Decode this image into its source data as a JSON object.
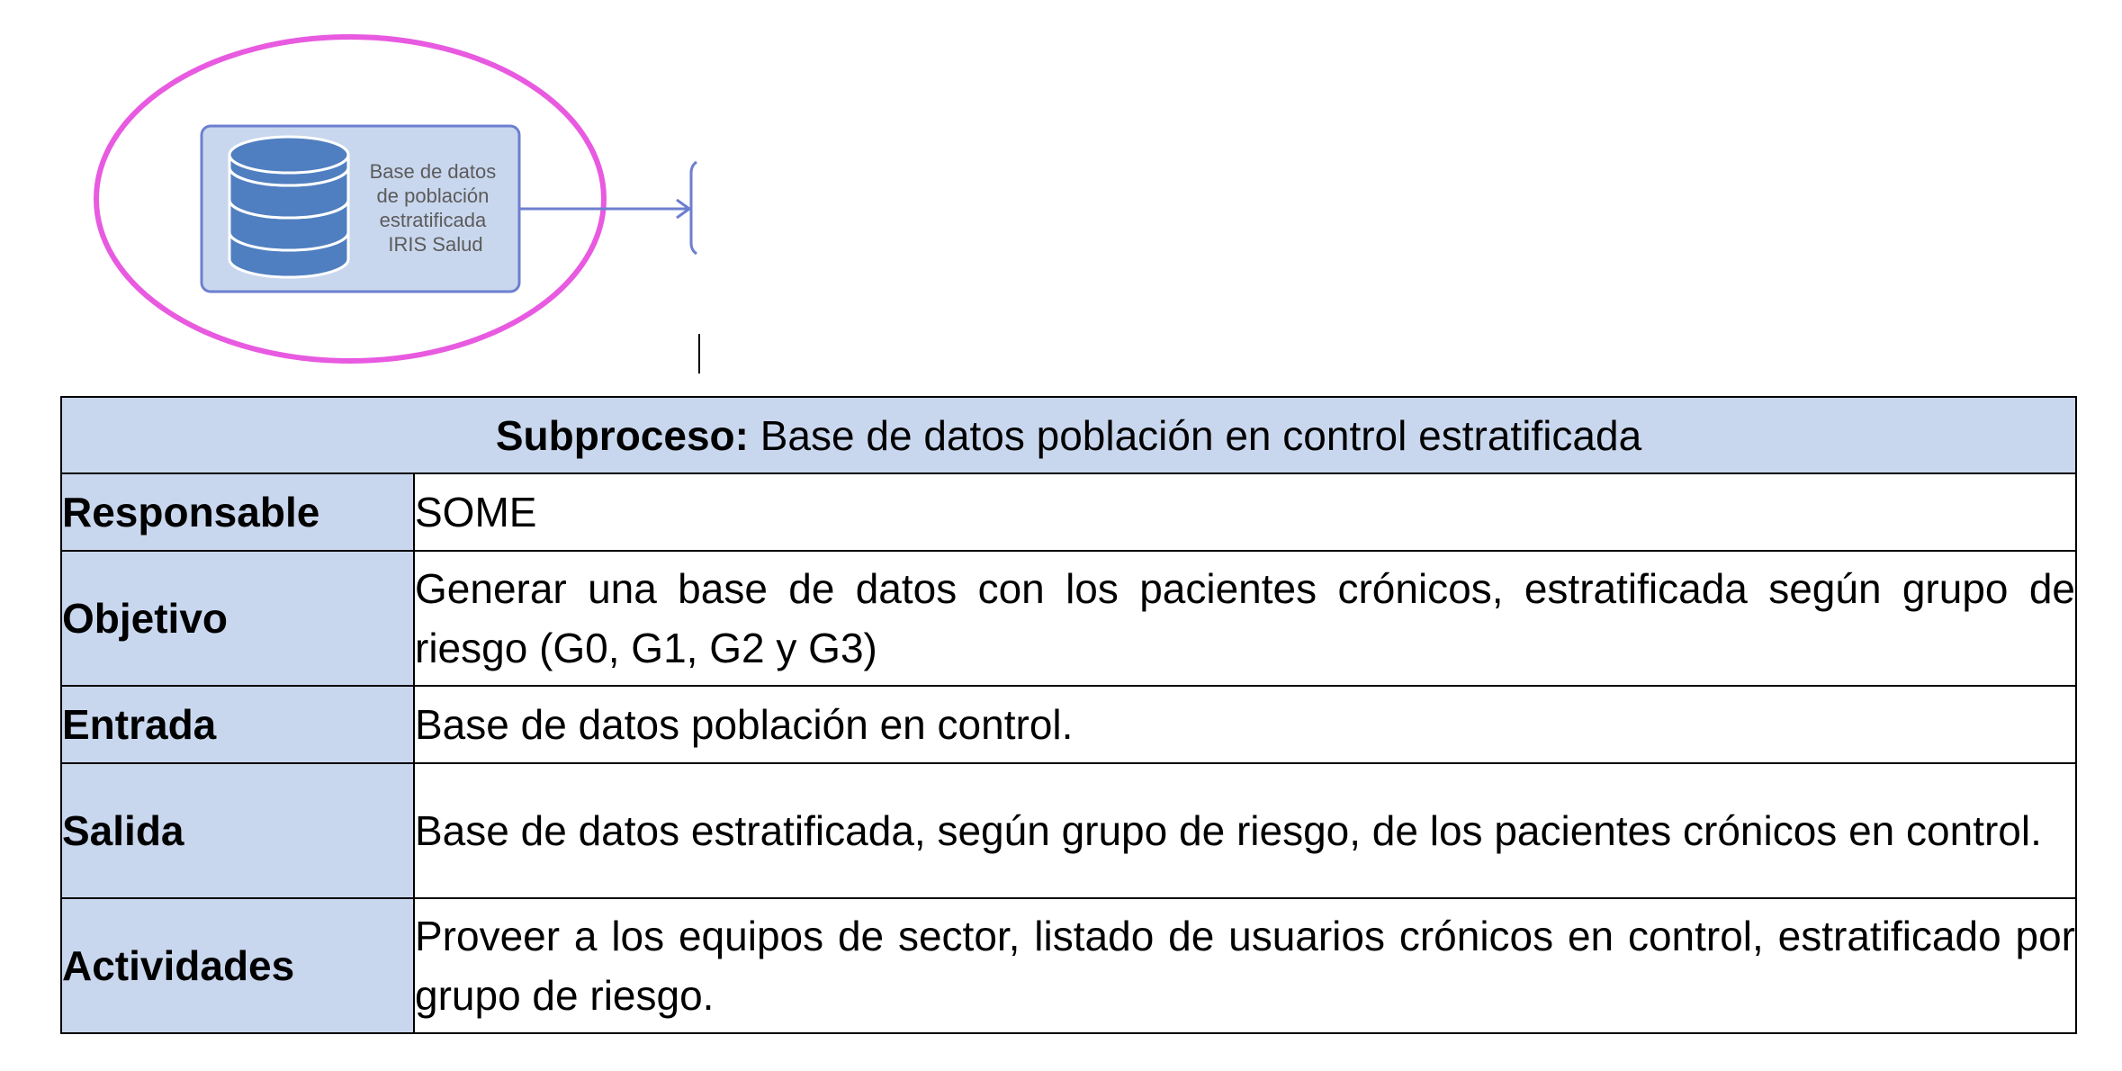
{
  "diagram": {
    "database_label_lines": [
      "Base de datos",
      "de población",
      "estratificada",
      "IRIS Salud"
    ],
    "highlight_color": "#e85ae0",
    "box_fill": "#c9d7ee",
    "box_border": "#6d7fcf",
    "db_icon": "database-icon",
    "db_icon_color": "#4f7fc0"
  },
  "table": {
    "header_bold": "Subproceso:",
    "header_text": " Base de datos población en control estratificada",
    "rows": [
      {
        "label": "Responsable",
        "value": "SOME"
      },
      {
        "label": "Objetivo",
        "value": "Generar una base de datos con los pacientes crónicos, estratificada según grupo de riesgo (G0, G1, G2 y G3)"
      },
      {
        "label": "Entrada",
        "value": "Base de datos población en control."
      },
      {
        "label": "Salida",
        "value": "Base de datos estratificada, según grupo de riesgo, de los pacientes crónicos en control."
      },
      {
        "label": "Actividades",
        "value": "Proveer a los equipos de sector, listado de usuarios crónicos en control, estratificado por grupo de riesgo."
      }
    ],
    "label_bg": "#c9d7ee"
  }
}
